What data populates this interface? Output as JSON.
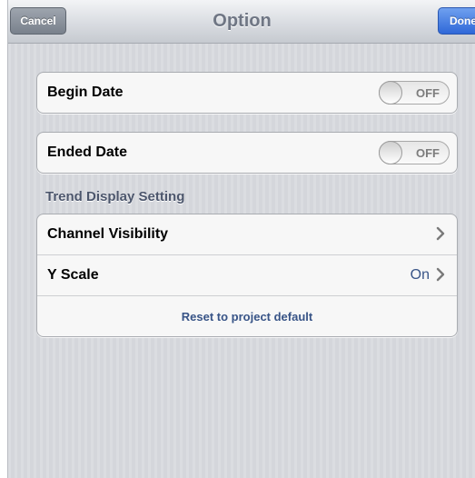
{
  "navbar": {
    "title": "Option",
    "cancel_label": "Cancel",
    "done_label": "Done"
  },
  "dates": {
    "begin": {
      "label": "Begin Date",
      "toggle": "OFF"
    },
    "ended": {
      "label": "Ended Date",
      "toggle": "OFF"
    }
  },
  "trend": {
    "header": "Trend Display Setting",
    "channel_visibility_label": "Channel Visibility",
    "y_scale_label": "Y Scale",
    "y_scale_value": "On",
    "reset_label": "Reset to project default"
  },
  "icons": {
    "disclosure": "chevron-right-icon"
  },
  "colors": {
    "accent": "#385487",
    "done_button": "#2f68d8",
    "background": "#d7d9de"
  }
}
